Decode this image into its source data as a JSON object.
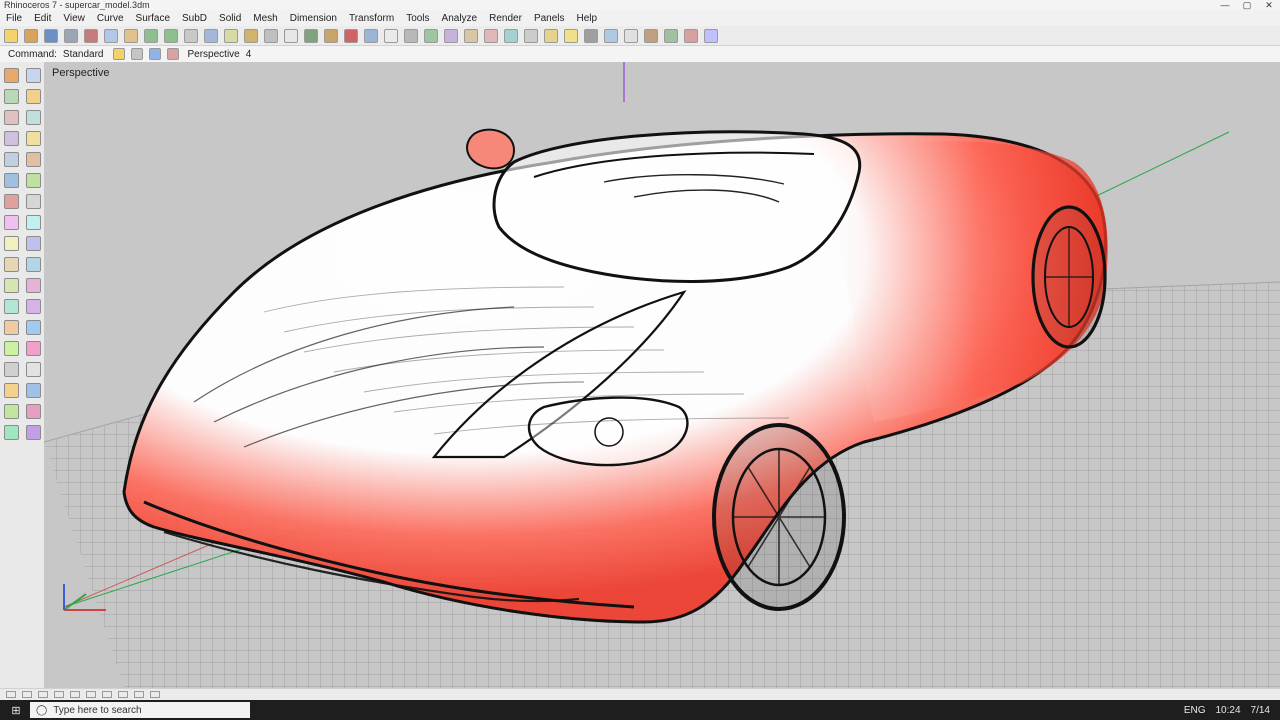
{
  "window": {
    "title": "Rhinoceros 7 - supercar_model.3dm",
    "min_symbol": "—",
    "max_symbol": "▢",
    "close_symbol": "✕"
  },
  "menu": [
    "File",
    "Edit",
    "View",
    "Curve",
    "Surface",
    "SubD",
    "Solid",
    "Mesh",
    "Dimension",
    "Transform",
    "Tools",
    "Analyze",
    "Render",
    "Panels",
    "Help"
  ],
  "command": {
    "prompt": "Command:",
    "left_tab": "Standard",
    "view_text": "Perspective",
    "view_num": "4"
  },
  "viewport": {
    "label": "Perspective"
  },
  "taskbar": {
    "search_placeholder": "Type here to search",
    "tray": [
      "ENG",
      "10:24",
      "7/14"
    ]
  }
}
